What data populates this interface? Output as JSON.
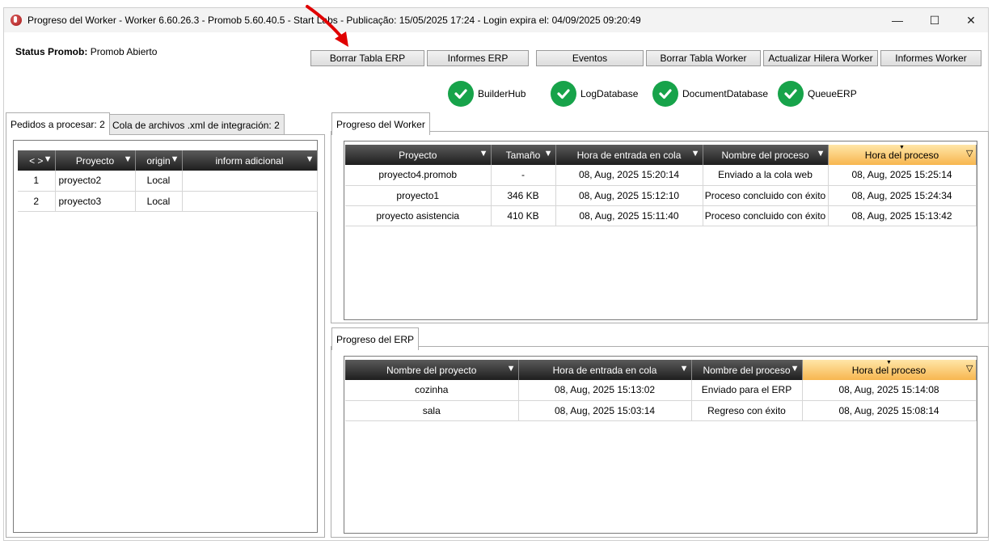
{
  "window": {
    "title": "Progreso del Worker  -  Worker 6.60.26.3  -  Promob 5.60.40.5  -  Start Labs  -  Publicação: 15/05/2025 17:24  - Login expira el: 04/09/2025 09:20:49",
    "minimize": "—",
    "maximize": "☐",
    "close": "✕"
  },
  "status": {
    "label": "Status Promob:",
    "value": "Promob Abierto"
  },
  "toolbar": {
    "borrar_erp": "Borrar Tabla ERP",
    "informes_erp": "Informes ERP",
    "eventos": "Eventos",
    "borrar_worker": "Borrar Tabla Worker",
    "actualizar_hilera": "Actualizar Hilera Worker",
    "informes_worker": "Informes Worker"
  },
  "connections": [
    {
      "label": "BuilderHub",
      "icon": "check-circle-icon",
      "color": "#17a34a"
    },
    {
      "label": "LogDatabase",
      "icon": "check-circle-icon",
      "color": "#17a34a"
    },
    {
      "label": "DocumentDatabase",
      "icon": "check-circle-icon",
      "color": "#17a34a"
    },
    {
      "label": "QueueERP",
      "icon": "check-circle-icon",
      "color": "#17a34a"
    }
  ],
  "left_tabs": {
    "pedidos": "Pedidos a procesar: 2",
    "cola": "Cola de archivos .xml de integración: 2"
  },
  "pedidos_table": {
    "headers": [
      "< >",
      "Proyecto",
      "origin",
      "inform adicional"
    ],
    "rows": [
      [
        "1",
        "proyecto2",
        "Local",
        ""
      ],
      [
        "2",
        "proyecto3",
        "Local",
        ""
      ]
    ]
  },
  "worker_tab": "Progreso del Worker",
  "worker_table": {
    "headers": [
      "Proyecto",
      "Tamaño",
      "Hora de entrada en cola",
      "Nombre del proceso",
      "Hora del proceso"
    ],
    "rows": [
      [
        "proyecto4.promob",
        "-",
        "08, Aug, 2025 15:20:14",
        "Enviado a la cola web",
        "08, Aug, 2025 15:25:14"
      ],
      [
        "proyecto1",
        "346 KB",
        "08, Aug, 2025 15:12:10",
        "Proceso concluido con éxito",
        "08, Aug, 2025 15:24:34"
      ],
      [
        "proyecto asistencia",
        "410 KB",
        "08, Aug, 2025 15:11:40",
        "Proceso concluido con éxito",
        "08, Aug, 2025 15:13:42"
      ]
    ]
  },
  "erp_tab": "Progreso del ERP",
  "erp_table": {
    "headers": [
      "Nombre del proyecto",
      "Hora de entrada en cola",
      "Nombre del proceso",
      "Hora del proceso"
    ],
    "rows": [
      [
        "cozinha",
        "08, Aug, 2025 15:13:02",
        "Enviado para el ERP",
        "08, Aug, 2025 15:14:08"
      ],
      [
        "sala",
        "08, Aug, 2025 15:03:14",
        "Regreso con éxito",
        "08, Aug, 2025 15:08:14"
      ]
    ]
  },
  "colors": {
    "header_dark": "#1e1e1e",
    "header_sorted": "#f7b64f",
    "status_ok": "#17a34a",
    "annotation_arrow": "#e00000"
  }
}
